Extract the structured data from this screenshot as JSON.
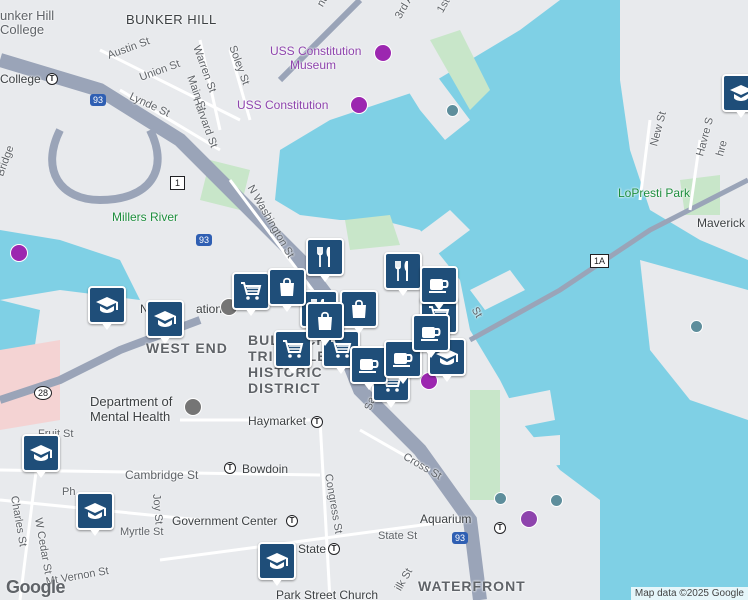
{
  "map": {
    "attribution": "Map data ©2025 Google",
    "logo": "Google",
    "colors": {
      "water": "#7fd0e5",
      "land": "#e8eaed",
      "park": "#c8e6c9",
      "road": "#ffffff",
      "highway": "#9aa4b8",
      "pin": "#1f4e79"
    }
  },
  "labels": {
    "bunker_hill": "BUNKER HILL",
    "bunker_hill_college_1": "unker Hill",
    "bunker_hill_college_2": "College",
    "college": "College",
    "west_end": "WEST END",
    "bulfinch_1": "BULFINCH",
    "bulfinch_2": "TRIANGLE",
    "bulfinch_3": "HISTORIC",
    "bulfinch_4": "DISTRICT",
    "dept_mental_1": "Department of",
    "dept_mental_2": "Mental Health",
    "haymarket": "Haymarket",
    "bowdoin": "Bowdoin",
    "government_center": "Government Center",
    "state": "State",
    "aquarium": "Aquarium",
    "waterfront": "WATERFRONT",
    "park_street": "Park Street Church",
    "uss_museum_1": "USS Constitution",
    "uss_museum_2": "Museum",
    "uss_constitution": "USS Constitution",
    "lopresti": "LoPresti Park",
    "maverick": "Maverick",
    "millers_river": "Millers River",
    "austin_st": "Austin St",
    "union_st": "Union St",
    "lynde_st": "Lynde St",
    "warren_st": "Warren St",
    "soley_st": "Soley St",
    "main_st": "Main St",
    "harvard_st": "Harvard St",
    "n_washington": "N Washington St",
    "cambridge_st": "Cambridge St",
    "congress_st": "Congress St",
    "cross_st": "Cross St",
    "state_st": "State St",
    "fruit_st": "Fruit St",
    "charles_st": "Charles St",
    "w_cedar_st": "W Cedar St",
    "joy_st": "Joy St",
    "myrtle_st": "Myrtle St",
    "mt_vernon_st": "Mt Vernon St",
    "new_st": "New St",
    "havre_st": "Havre S",
    "first_st": "1st",
    "third_ave": "3rd Av",
    "rte_93a": "93",
    "rte_93b": "93",
    "rte_93c": "93",
    "rte_1": "1",
    "rte_1a": "1A",
    "rte_28": "28",
    "bridge": "Bridge",
    "n_station": "N",
    "station": "ation",
    "phi": "Ph",
    "sa": "Sa",
    "st_frag": "St",
    "nt_st": "nt St",
    "hre": "hre",
    "ilk_st": "ilk St"
  },
  "markers": [
    {
      "type": "school"
    },
    {
      "type": "school"
    },
    {
      "type": "school"
    },
    {
      "type": "school"
    },
    {
      "type": "school"
    },
    {
      "type": "school"
    },
    {
      "type": "school"
    },
    {
      "type": "restaurant"
    },
    {
      "type": "restaurant"
    },
    {
      "type": "restaurant"
    },
    {
      "type": "grocery"
    },
    {
      "type": "grocery"
    },
    {
      "type": "grocery"
    },
    {
      "type": "grocery"
    },
    {
      "type": "grocery"
    },
    {
      "type": "shopping"
    },
    {
      "type": "shopping"
    },
    {
      "type": "shopping"
    },
    {
      "type": "cafe"
    },
    {
      "type": "cafe"
    },
    {
      "type": "cafe"
    },
    {
      "type": "cafe"
    }
  ]
}
